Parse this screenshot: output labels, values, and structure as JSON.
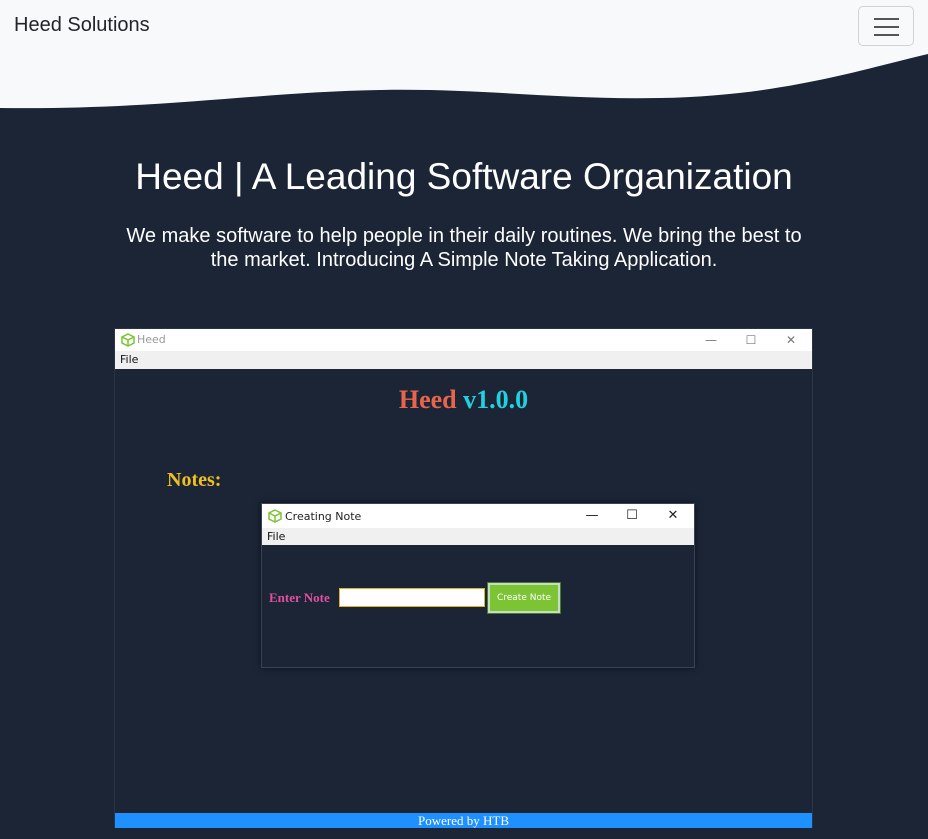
{
  "navbar": {
    "brand": "Heed Solutions",
    "toggle_icon": "hamburger-icon"
  },
  "hero": {
    "title": "Heed | A Leading Software Organization",
    "text": "We make software to help people in their daily routines. We bring the best to the market. Introducing A Simple Note Taking Application."
  },
  "app_window": {
    "title": "Heed",
    "icon": "cube-icon",
    "controls": [
      "—",
      "☐",
      "✕"
    ],
    "menu": {
      "file": "File"
    },
    "heading_part1": "Heed",
    "heading_part2": "v1.0.0",
    "notes_label": "Notes:",
    "footer": "Powered by HTB",
    "colors": {
      "heading_part1": "#e8644c",
      "heading_part2": "#22d0e0",
      "notes_label": "#f0c020",
      "footer_bg": "#1e90ff",
      "background": "#1b2536"
    }
  },
  "dialog": {
    "title": "Creating Note",
    "icon": "cube-icon",
    "controls": [
      "—",
      "☐",
      "✕"
    ],
    "menu": {
      "file": "File"
    },
    "enter_label": "Enter Note",
    "input_value": "",
    "button_label": "Create Note",
    "colors": {
      "enter_label": "#e050a0",
      "button_bg": "#7cc434"
    }
  }
}
